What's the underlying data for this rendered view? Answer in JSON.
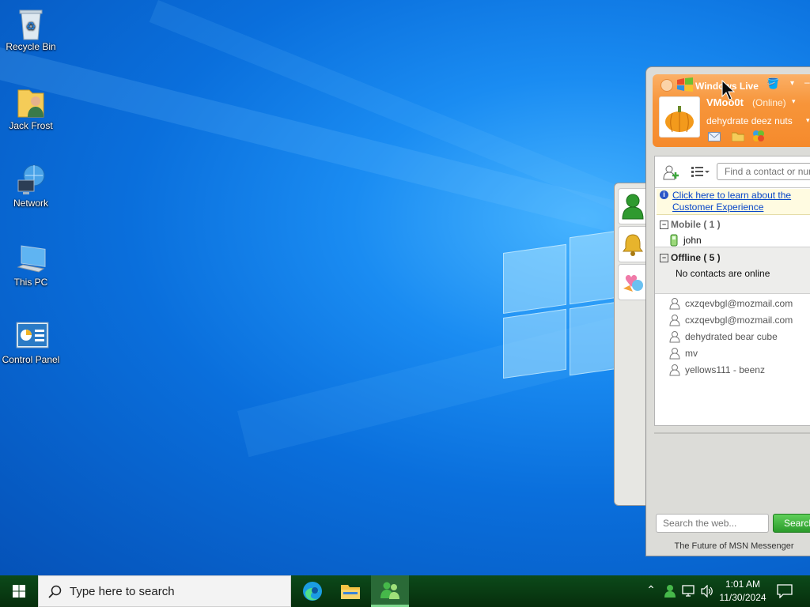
{
  "desktop": {
    "icons": [
      {
        "label": "Recycle Bin",
        "icon": "recycle-bin-icon"
      },
      {
        "label": "Jack Frost",
        "icon": "user-folder-icon"
      },
      {
        "label": "Network",
        "icon": "network-icon"
      },
      {
        "label": "This PC",
        "icon": "computer-icon"
      },
      {
        "label": "Control Panel",
        "icon": "control-panel-icon"
      }
    ]
  },
  "msn": {
    "brand": "Windows Live",
    "username": "VMoo0t",
    "status": "(Online)",
    "personal_message": "dehydrate deez nuts",
    "search_placeholder": "Find a contact or num",
    "info_link": "Click here to learn about the Customer Experience",
    "groups": [
      {
        "label": "Mobile ( 1 )",
        "contacts": [
          "john"
        ]
      },
      {
        "label": "Offline ( 5 )",
        "note": "No contacts are online",
        "contacts": [
          "cxzqevbgl@mozmail.com",
          "cxzqevbgl@mozmail.com",
          "dehydrated bear cube",
          "mv",
          "yellows111 - beenz"
        ]
      }
    ],
    "web_search_placeholder": "Search the web...",
    "web_search_button": "Search",
    "footer": "The Future of MSN Messenger"
  },
  "taskbar": {
    "search_placeholder": "Type here to search",
    "time": "1:01 AM",
    "date": "11/30/2024"
  }
}
